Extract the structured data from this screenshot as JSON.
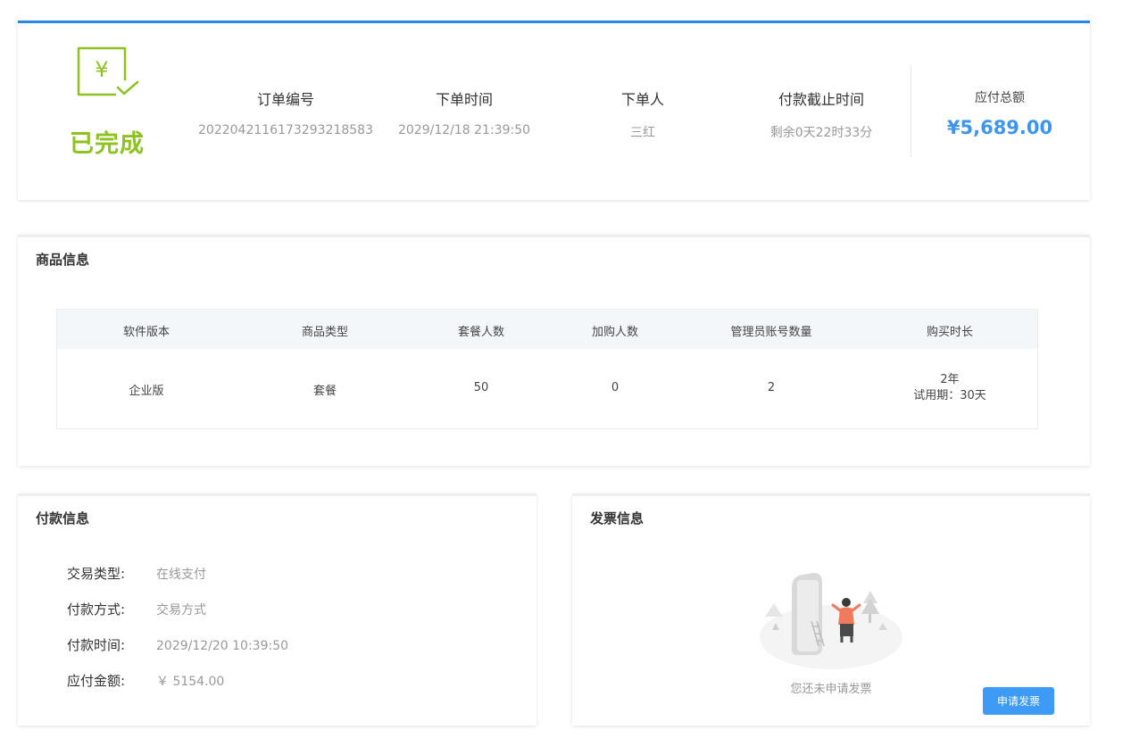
{
  "order": {
    "status": "已完成",
    "fields": [
      {
        "label": "订单编号",
        "value": "2022042116173293218583"
      },
      {
        "label": "下单时间",
        "value": "2029/12/18 21:39:50"
      },
      {
        "label": "下单人",
        "value": "三红"
      },
      {
        "label": "付款截止时间",
        "value": "剩余0天22时33分"
      }
    ],
    "total_label": "应付总额",
    "total_value": "¥5,689.00",
    "icon": "yen-check-icon",
    "accent_color": "#8dc21f",
    "price_color": "#3d96ec"
  },
  "product": {
    "title": "商品信息",
    "headers": [
      "软件版本",
      "商品类型",
      "套餐人数",
      "加购人数",
      "管理员账号数量",
      "购买时长"
    ],
    "row": {
      "version": "企业版",
      "type": "套餐",
      "package_users": "50",
      "extra_users": "0",
      "admin_accounts": "2",
      "duration": "2年",
      "trial": "试用期：30天"
    }
  },
  "payment": {
    "title": "付款信息",
    "rows": [
      {
        "label": "交易类型:",
        "value": "在线支付"
      },
      {
        "label": "付款方式:",
        "value": "交易方式"
      },
      {
        "label": "付款时间:",
        "value": "2029/12/20 10:39:50"
      },
      {
        "label": "应付金额:",
        "value": "￥ 5154.00"
      }
    ]
  },
  "invoice": {
    "title": "发票信息",
    "empty_text": "您还未申请发票",
    "apply_button": "申请发票",
    "button_color": "#3d9bf5"
  }
}
